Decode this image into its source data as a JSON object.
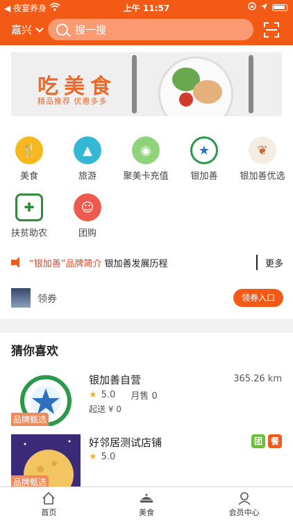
{
  "status_bar": {
    "carrier": "◀ 夜宴养身",
    "time": "上午 11:57"
  },
  "header": {
    "city": "嘉兴",
    "search_placeholder": "搜一搜"
  },
  "banner": {
    "title": "吃美食",
    "subtitle": "精品推荐 优惠多多"
  },
  "categories": [
    {
      "label": "美食",
      "color": "#f7b71e",
      "icon": "fork-knife-icon"
    },
    {
      "label": "旅游",
      "color": "#35b8d6",
      "icon": "mountain-icon"
    },
    {
      "label": "聚美卡充值",
      "color": "#8fd37a",
      "icon": "card-icon"
    },
    {
      "label": "银加善",
      "color": "#2a9a4a",
      "icon": "yinjiashan-logo"
    },
    {
      "label": "银加善优选",
      "color": "#d7b58a",
      "icon": "leaf-logo"
    },
    {
      "label": "扶贫助农",
      "color": "#2f8a3a",
      "icon": "poverty-aid-logo"
    },
    {
      "label": "团购",
      "color": "#f05a4e",
      "icon": "group-buy-icon"
    }
  ],
  "notice": {
    "highlight": "“银加善”品牌简介",
    "text": "银加善发展历程",
    "more": "更多"
  },
  "coupon": {
    "label": "领券",
    "button": "领券入口"
  },
  "recommend": {
    "heading": "猜你喜欢",
    "stores": [
      {
        "name": "银加善自营",
        "rating": "5.0",
        "monthly_sales": "月售 0",
        "distance": "365.26 km",
        "min_ship": "起送 ¥ 0",
        "tag": "品牌甄选"
      },
      {
        "name": "好邻居测试店铺",
        "rating": "5.0",
        "tag": "品牌甄选",
        "badges": [
          "团",
          "餐"
        ]
      }
    ]
  },
  "tabbar": {
    "tabs": [
      "首页",
      "美食",
      "会员中心"
    ]
  }
}
